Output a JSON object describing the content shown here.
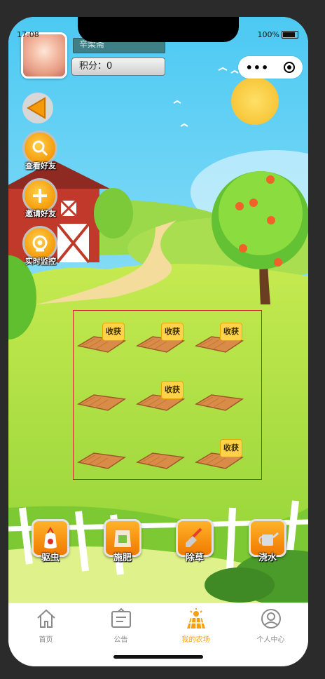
{
  "status_bar": {
    "time": "17:08",
    "battery": "100%"
  },
  "header": {
    "username": "辛柔斋",
    "score_label": "积分：",
    "score_value": "0"
  },
  "side_buttons": [
    {
      "label": "查看好友",
      "icon": "search-icon"
    },
    {
      "label": "邀请好友",
      "icon": "plus-icon"
    },
    {
      "label": "实时监控",
      "icon": "camera-icon"
    }
  ],
  "plots": [
    {
      "harvest": "收获"
    },
    {
      "harvest": "收获"
    },
    {
      "harvest": "收获"
    },
    {
      "harvest": ""
    },
    {
      "harvest": "收获"
    },
    {
      "harvest": ""
    },
    {
      "harvest": ""
    },
    {
      "harvest": ""
    },
    {
      "harvest": "收获"
    }
  ],
  "tools": [
    {
      "label": "驱虫",
      "icon": "pesticide-icon"
    },
    {
      "label": "施肥",
      "icon": "fertilizer-icon"
    },
    {
      "label": "除草",
      "icon": "shovel-icon"
    },
    {
      "label": "浇水",
      "icon": "watering-can-icon"
    }
  ],
  "tabs": [
    {
      "label": "首页",
      "icon": "home-icon"
    },
    {
      "label": "公告",
      "icon": "notice-icon"
    },
    {
      "label": "我的农场",
      "icon": "farm-icon"
    },
    {
      "label": "个人中心",
      "icon": "user-icon"
    }
  ],
  "active_tab": "我的农场",
  "colors": {
    "accent": "#f5a012",
    "field_border": "#d0202a",
    "harvest_badge": "#ffd24a"
  }
}
